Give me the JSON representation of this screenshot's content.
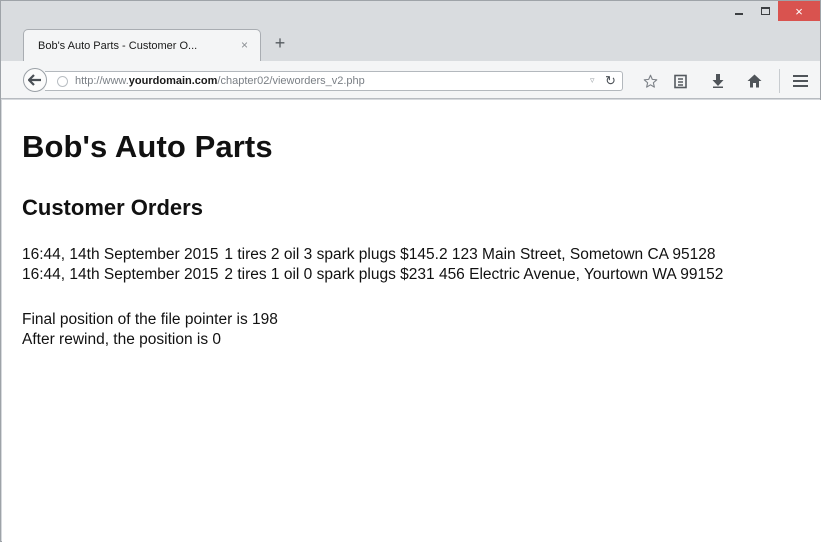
{
  "browser": {
    "tab_title": "Bob's Auto Parts - Customer O...",
    "tab_close": "×",
    "new_tab": "+",
    "url_prefix": "http://www.",
    "url_domain": "yourdomain.com",
    "url_path": "/chapter02/vieworders_v2.php",
    "window_close": "×",
    "icons": [
      "back-arrow-icon",
      "globe-icon",
      "dropdown-icon",
      "reload-icon",
      "star-icon",
      "reading-list-icon",
      "download-icon",
      "home-icon",
      "menu-icon"
    ]
  },
  "page": {
    "heading": "Bob's Auto Parts",
    "subheading": "Customer Orders",
    "orders": [
      "16:44, 14th September 2015\t1 tires 2 oil 3 spark plugs $145.2 123 Main Street, Sometown CA 95128",
      "16:44, 14th September 2015\t2 tires 1 oil 0 spark plugs $231 456 Electric Avenue, Yourtown WA 99152"
    ],
    "pointer_final": "Final position of the file pointer is 198",
    "pointer_rewind": "After rewind, the position is 0"
  },
  "colors": {
    "close_button": "#d9534f",
    "chrome_bg": "#d9dcdf",
    "toolbar_bg": "#f4f5f6"
  }
}
